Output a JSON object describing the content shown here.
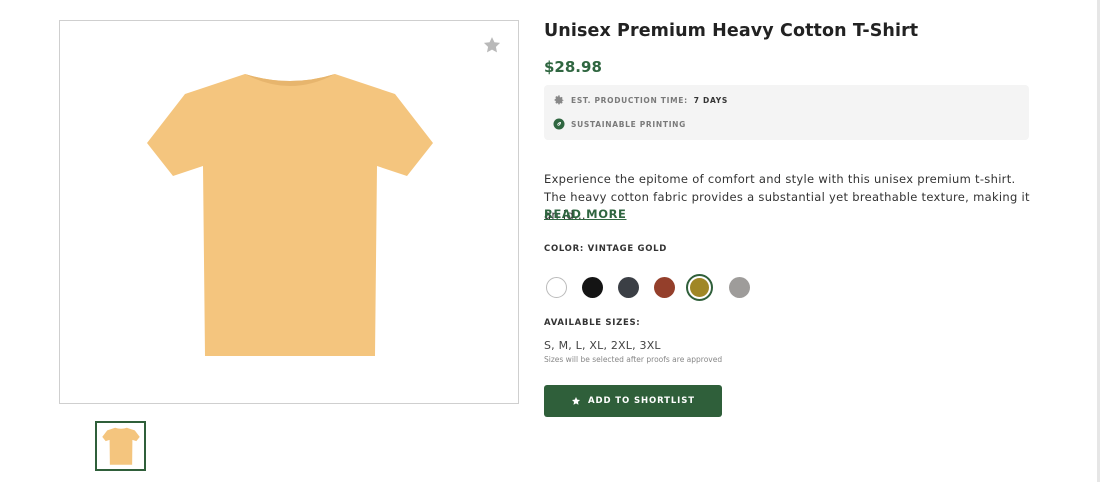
{
  "product": {
    "title": "Unisex Premium Heavy Cotton T-Shirt",
    "price": "$28.98",
    "image_color": "#f4c57e",
    "favorite_icon": "star-icon"
  },
  "info": {
    "production_label": "EST. PRODUCTION TIME:",
    "production_value": "7 DAYS",
    "production_icon": "gear-icon",
    "sustainable_label": "SUSTAINABLE PRINTING",
    "sustainable_icon": "leaf-icon"
  },
  "description": {
    "text": "Experience the epitome of comfort and style with this unisex premium t-shirt. The heavy cotton fabric provides a substantial yet breathable texture, making it an id...",
    "read_more": "READ MORE"
  },
  "color": {
    "label": "COLOR: VINTAGE GOLD",
    "swatches": [
      {
        "color": "#ffffff",
        "border": "#bbbbbb",
        "selected": false
      },
      {
        "color": "#141414",
        "selected": false
      },
      {
        "color": "#3b3f45",
        "selected": false
      },
      {
        "color": "#943f2b",
        "selected": false
      },
      {
        "color": "#a08726",
        "selected": true
      },
      {
        "color": "#9e9c9a",
        "selected": false
      }
    ]
  },
  "sizes": {
    "label": "AVAILABLE SIZES:",
    "values": "S, M, L, XL, 2XL, 3XL",
    "note": "Sizes will be selected after proofs are approved"
  },
  "actions": {
    "add_label": "ADD TO SHORTLIST",
    "add_icon": "star-icon"
  },
  "colors": {
    "accent": "#2f5f3a",
    "price": "#2f6640"
  }
}
